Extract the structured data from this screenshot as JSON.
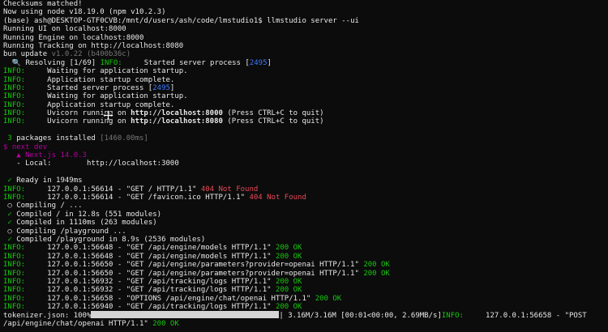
{
  "terminal": {
    "lines": [
      [
        {
          "t": "Checksums matched!",
          "c": "c-white"
        }
      ],
      [
        {
          "t": "Now using node v18.19.0 (npm v10.2.3)",
          "c": "c-white"
        }
      ],
      [
        {
          "t": "(base) ",
          "c": "c-white"
        },
        {
          "t": "ash@DESKTOP-GTF0CVB:/mnt/d/users/ash/code/lmstudio1",
          "c": "c-white"
        },
        {
          "t": "$ llmstudio server --ui",
          "c": "c-white"
        }
      ],
      [
        {
          "t": "Running UI on localhost:8000",
          "c": "c-white"
        }
      ],
      [
        {
          "t": "Running Engine on localhost:8000",
          "c": "c-white"
        }
      ],
      [
        {
          "t": "Running Tracking on http://localhost:8080",
          "c": "c-white"
        }
      ],
      [
        {
          "t": "bun update ",
          "c": "c-white"
        },
        {
          "t": "v1.0.22 (b400b36c)",
          "c": "c-gray"
        }
      ],
      [
        {
          "t": "  🔍 Resolving [1/69] ",
          "c": "c-white"
        },
        {
          "t": "INFO:",
          "c": "c-green"
        },
        {
          "t": "     Started server process [",
          "c": "c-white"
        },
        {
          "t": "2495",
          "c": "c-blue"
        },
        {
          "t": "]",
          "c": "c-white"
        }
      ],
      [
        {
          "t": "INFO:",
          "c": "c-green"
        },
        {
          "t": "     Waiting for application startup.",
          "c": "c-white"
        }
      ],
      [
        {
          "t": "INFO:",
          "c": "c-green"
        },
        {
          "t": "     Application startup complete.",
          "c": "c-white"
        }
      ],
      [
        {
          "t": "INFO:",
          "c": "c-green"
        },
        {
          "t": "     Started server process [",
          "c": "c-white"
        },
        {
          "t": "2495",
          "c": "c-blue"
        },
        {
          "t": "]",
          "c": "c-white"
        }
      ],
      [
        {
          "t": "INFO:",
          "c": "c-green"
        },
        {
          "t": "     Waiting for application startup.",
          "c": "c-white"
        }
      ],
      [
        {
          "t": "INFO:",
          "c": "c-green"
        },
        {
          "t": "     Application startup complete.",
          "c": "c-white"
        }
      ],
      [
        {
          "t": "INFO:",
          "c": "c-green"
        },
        {
          "t": "     Uvicorn running on ",
          "c": "c-white"
        },
        {
          "t": "http://localhost:8000",
          "c": "c-white bold"
        },
        {
          "t": " (Press CTRL+C to quit)",
          "c": "c-white"
        }
      ],
      [
        {
          "t": "INFO:",
          "c": "c-green"
        },
        {
          "t": "     Uvicorn running on ",
          "c": "c-white"
        },
        {
          "t": "http://localhost:8080",
          "c": "c-white bold"
        },
        {
          "t": " (Press CTRL+C to quit)",
          "c": "c-white"
        }
      ],
      [
        {
          "t": "",
          "c": "c-white"
        }
      ],
      [
        {
          "t": " 3 ",
          "c": "c-green"
        },
        {
          "t": "packages installed ",
          "c": "c-white"
        },
        {
          "t": "[1460.00ms]",
          "c": "c-gray"
        }
      ],
      [
        {
          "t": "$ next dev",
          "c": "c-mag"
        }
      ],
      [
        {
          "t": "   ▲ Next.js 14.0.3",
          "c": "c-mag"
        }
      ],
      [
        {
          "t": "   - Local:        http://localhost:3000",
          "c": "c-white"
        }
      ],
      [
        {
          "t": "",
          "c": "c-white"
        }
      ],
      [
        {
          "t": " ✓ ",
          "c": "c-green"
        },
        {
          "t": "Ready in 1949ms",
          "c": "c-white"
        }
      ],
      [
        {
          "t": "INFO:",
          "c": "c-green"
        },
        {
          "t": "     127.0.0.1:56614 - \"GET / HTTP/1.1\" ",
          "c": "c-white"
        },
        {
          "t": "404 Not Found",
          "c": "c-red"
        }
      ],
      [
        {
          "t": "INFO:",
          "c": "c-green"
        },
        {
          "t": "     127.0.0.1:56614 - \"GET /favicon.ico HTTP/1.1\" ",
          "c": "c-white"
        },
        {
          "t": "404 Not Found",
          "c": "c-red"
        }
      ],
      [
        {
          "t": " ○ ",
          "c": "c-white"
        },
        {
          "t": "Compiling / ...",
          "c": "c-white"
        }
      ],
      [
        {
          "t": " ✓ ",
          "c": "c-green"
        },
        {
          "t": "Compiled / in 12.8s (551 modules)",
          "c": "c-white"
        }
      ],
      [
        {
          "t": " ✓ ",
          "c": "c-green"
        },
        {
          "t": "Compiled in 1110ms (263 modules)",
          "c": "c-white"
        }
      ],
      [
        {
          "t": " ○ ",
          "c": "c-white"
        },
        {
          "t": "Compiling /playground ...",
          "c": "c-white"
        }
      ],
      [
        {
          "t": " ✓ ",
          "c": "c-green"
        },
        {
          "t": "Compiled /playground in 8.9s (2536 modules)",
          "c": "c-white"
        }
      ],
      [
        {
          "t": "INFO:",
          "c": "c-green"
        },
        {
          "t": "     127.0.0.1:56648 - \"GET /api/engine/models HTTP/1.1\" ",
          "c": "c-white"
        },
        {
          "t": "200 OK",
          "c": "c-green"
        }
      ],
      [
        {
          "t": "INFO:",
          "c": "c-green"
        },
        {
          "t": "     127.0.0.1:56648 - \"GET /api/engine/models HTTP/1.1\" ",
          "c": "c-white"
        },
        {
          "t": "200 OK",
          "c": "c-green"
        }
      ],
      [
        {
          "t": "INFO:",
          "c": "c-green"
        },
        {
          "t": "     127.0.0.1:56650 - \"GET /api/engine/parameters?provider=openai HTTP/1.1\" ",
          "c": "c-white"
        },
        {
          "t": "200 OK",
          "c": "c-green"
        }
      ],
      [
        {
          "t": "INFO:",
          "c": "c-green"
        },
        {
          "t": "     127.0.0.1:56650 - \"GET /api/engine/parameters?provider=openai HTTP/1.1\" ",
          "c": "c-white"
        },
        {
          "t": "200 OK",
          "c": "c-green"
        }
      ],
      [
        {
          "t": "INFO:",
          "c": "c-green"
        },
        {
          "t": "     127.0.0.1:56932 - \"GET /api/tracking/logs HTTP/1.1\" ",
          "c": "c-white"
        },
        {
          "t": "200 OK",
          "c": "c-green"
        }
      ],
      [
        {
          "t": "INFO:",
          "c": "c-green"
        },
        {
          "t": "     127.0.0.1:56932 - \"GET /api/tracking/logs HTTP/1.1\" ",
          "c": "c-white"
        },
        {
          "t": "200 OK",
          "c": "c-green"
        }
      ],
      [
        {
          "t": "INFO:",
          "c": "c-green"
        },
        {
          "t": "     127.0.0.1:56658 - \"OPTIONS /api/engine/chat/openai HTTP/1.1\" ",
          "c": "c-white"
        },
        {
          "t": "200 OK",
          "c": "c-green"
        }
      ],
      [
        {
          "t": "INFO:",
          "c": "c-green"
        },
        {
          "t": "     127.0.0.1:56940 - \"GET /api/tracking/logs HTTP/1.1\" ",
          "c": "c-white"
        },
        {
          "t": "200 OK",
          "c": "c-green"
        }
      ],
      [
        {
          "t": "tokenizer.json: 100%",
          "c": "c-white"
        },
        {
          "t": "BAR",
          "c": "bar"
        },
        {
          "t": "| 3.16M/3.16M [00:01<00:00, 2.69MB/s]",
          "c": "c-white"
        },
        {
          "t": "INFO:",
          "c": "c-green"
        },
        {
          "t": "     127.0.0.1:56658 - \"POST",
          "c": "c-white"
        }
      ],
      [
        {
          "t": "/api/engine/chat/openai HTTP/1.1\" ",
          "c": "c-white"
        },
        {
          "t": "200 OK",
          "c": "c-green"
        }
      ]
    ],
    "progress": {
      "label": "tokenizer.json: 100%",
      "fraction": 1.0
    }
  },
  "cursor_icon": "move-cursor-icon"
}
